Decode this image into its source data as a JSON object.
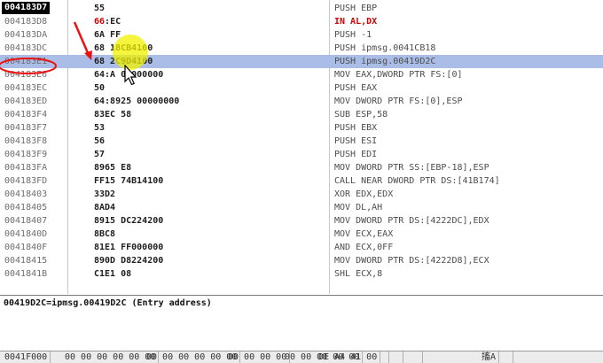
{
  "disassembly": {
    "selected_index": 4,
    "rows": [
      {
        "addr": "004183D7",
        "hex": "55",
        "hex_red": "",
        "instr": "PUSH EBP",
        "red": false
      },
      {
        "addr": "004183D8",
        "hex": ":EC",
        "hex_red": "66",
        "instr": "IN AL,DX",
        "red": true
      },
      {
        "addr": "004183DA",
        "hex": "6A FF",
        "hex_red": "",
        "instr": "PUSH -1",
        "red": false
      },
      {
        "addr": "004183DC",
        "hex": "68 18CB4100",
        "hex_red": "",
        "instr": "PUSH ipmsg.0041CB18",
        "red": false
      },
      {
        "addr": "004183E1",
        "hex": "68 2C9D4100",
        "hex_red": "",
        "instr": "PUSH ipmsg.00419D2C",
        "red": false
      },
      {
        "addr": "004183E6",
        "hex": "64:A 00000000",
        "hex_red": "",
        "instr": "MOV EAX,DWORD PTR FS:[0]",
        "red": false
      },
      {
        "addr": "004183EC",
        "hex": "50",
        "hex_red": "",
        "instr": "PUSH EAX",
        "red": false
      },
      {
        "addr": "004183ED",
        "hex": "64:8925 00000000",
        "hex_red": "",
        "instr": "MOV DWORD PTR FS:[0],ESP",
        "red": false
      },
      {
        "addr": "004183F4",
        "hex": "83EC 58",
        "hex_red": "",
        "instr": "SUB ESP,58",
        "red": false
      },
      {
        "addr": "004183F7",
        "hex": "53",
        "hex_red": "",
        "instr": "PUSH EBX",
        "red": false
      },
      {
        "addr": "004183F8",
        "hex": "56",
        "hex_red": "",
        "instr": "PUSH ESI",
        "red": false
      },
      {
        "addr": "004183F9",
        "hex": "57",
        "hex_red": "",
        "instr": "PUSH EDI",
        "red": false
      },
      {
        "addr": "004183FA",
        "hex": "8965 E8",
        "hex_red": "",
        "instr": "MOV DWORD PTR SS:[EBP-18],ESP",
        "red": false
      },
      {
        "addr": "004183FD",
        "hex": "FF15 74B14100",
        "hex_red": "",
        "instr": "CALL NEAR DWORD PTR DS:[41B174]",
        "red": false
      },
      {
        "addr": "00418403",
        "hex": "33D2",
        "hex_red": "",
        "instr": "XOR EDX,EDX",
        "red": false
      },
      {
        "addr": "00418405",
        "hex": "8AD4",
        "hex_red": "",
        "instr": "MOV DL,AH",
        "red": false
      },
      {
        "addr": "00418407",
        "hex": "8915 DC224200",
        "hex_red": "",
        "instr": "MOV DWORD PTR DS:[4222DC],EDX",
        "red": false
      },
      {
        "addr": "0041840D",
        "hex": "8BC8",
        "hex_red": "",
        "instr": "MOV ECX,EAX",
        "red": false
      },
      {
        "addr": "0041840F",
        "hex": "81E1 FF000000",
        "hex_red": "",
        "instr": "AND ECX,0FF",
        "red": false
      },
      {
        "addr": "00418415",
        "hex": "890D D8224200",
        "hex_red": "",
        "instr": "MOV DWORD PTR DS:[4222D8],ECX",
        "red": false
      },
      {
        "addr": "0041841B",
        "hex": "C1E1 08",
        "hex_red": "",
        "instr": "SHL ECX,8",
        "red": false
      }
    ]
  },
  "info_pane": {
    "text": "00419D2C=ipmsg.00419D2C (Entry address)"
  },
  "dump_bar": {
    "cells": [
      "0041F000",
      "00 00 00 00 00 00",
      "00 00 00 00 00 00",
      "00 00 00 00",
      "00 00 00 00 00",
      "DE A4 41 00",
      "",
      "",
      "",
      "搐A",
      ""
    ]
  },
  "colors": {
    "selection": "#a9bde6",
    "highlight_red": "#d30000",
    "annotation_yellow": "#f2f200"
  },
  "icons": {
    "cursor": "mouse-pointer-icon",
    "arrow": "red-arrow-annotation"
  }
}
